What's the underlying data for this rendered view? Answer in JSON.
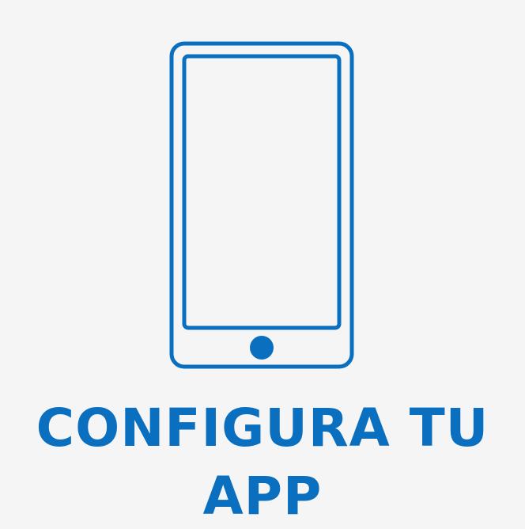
{
  "icon": {
    "name": "smartphone-icon",
    "color": "#0b6fbf"
  },
  "caption": {
    "line1": "CONFIGURA TU",
    "line2": "APP"
  },
  "colors": {
    "background": "#f5f5f6",
    "accent": "#0b6fbf"
  }
}
